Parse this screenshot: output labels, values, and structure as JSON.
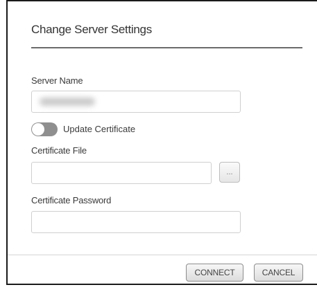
{
  "dialog": {
    "title": "Change Server Settings",
    "server_name": {
      "label": "Server Name",
      "value": ""
    },
    "update_certificate": {
      "label": "Update Certificate",
      "enabled": false
    },
    "certificate_file": {
      "label": "Certificate File",
      "value": "",
      "browse_label": "..."
    },
    "certificate_password": {
      "label": "Certificate Password",
      "value": ""
    },
    "buttons": {
      "connect": "CONNECT",
      "cancel": "CANCEL"
    }
  },
  "colors": {
    "toggle_off": "#8f8f8f",
    "title_rule": "#6a6a6a",
    "field_border": "#cfcfcf"
  }
}
